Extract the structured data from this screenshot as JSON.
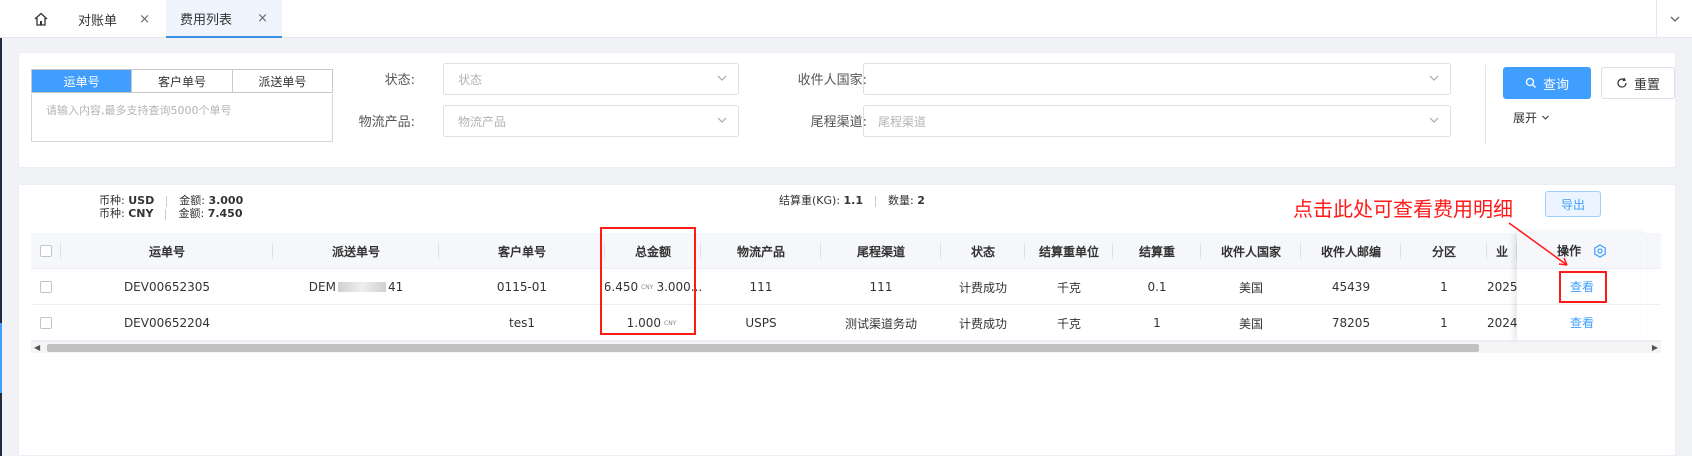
{
  "tabs": {
    "home_icon": "home-icon",
    "items": [
      {
        "label": "对账单",
        "close": "×"
      },
      {
        "label": "费用列表",
        "close": "×"
      }
    ]
  },
  "filter": {
    "seg_tabs": [
      "运单号",
      "客户单号",
      "派送单号"
    ],
    "textarea_placeholder": "请输入内容,最多支持查询5000个单号",
    "status_label": "状态:",
    "status_placeholder": "状态",
    "country_label": "收件人国家:",
    "country_value": "",
    "product_label": "物流产品:",
    "product_placeholder": "物流产品",
    "lastmile_label": "尾程渠道:",
    "lastmile_placeholder": "尾程渠道",
    "query_label": "查询",
    "reset_label": "重置",
    "expand_label": "展开"
  },
  "summary": {
    "currency_label": "币种:",
    "amount_label": "金额:",
    "rows": [
      {
        "currency": "USD",
        "amount": "3.000"
      },
      {
        "currency": "CNY",
        "amount": "7.450"
      }
    ],
    "weight_label": "结算重(KG):",
    "weight": "1.1",
    "count_label": "数量:",
    "count": "2",
    "export_label": "导出"
  },
  "annotation": "点击此处可查看费用明细",
  "table": {
    "columns": [
      "运单号",
      "派送单号",
      "客户单号",
      "总金额",
      "物流产品",
      "尾程渠道",
      "状态",
      "结算重单位",
      "结算重",
      "收件人国家",
      "收件人邮编",
      "分区",
      "业"
    ],
    "action_header": "操作",
    "rows": [
      {
        "waybill": "DEV00652305",
        "delivery_prefix": "DEM",
        "delivery_suffix": "41",
        "customer": "0115-01",
        "amount_a": "6.450",
        "amount_unit": "CNY",
        "amount_b": "3.000...",
        "product": "111",
        "lastmile": "111",
        "status": "计费成功",
        "unit": "千克",
        "weight": "0.1",
        "country": "美国",
        "zip": "45439",
        "zone": "1",
        "date": "2025",
        "action": "查看"
      },
      {
        "waybill": "DEV00652204",
        "delivery_prefix": "",
        "delivery_suffix": "",
        "customer": "tes1",
        "amount_a": "1.000",
        "amount_unit": "CNY",
        "amount_b": "",
        "product": "USPS",
        "lastmile": "测试渠道务动",
        "status": "计费成功",
        "unit": "千克",
        "weight": "1",
        "country": "美国",
        "zip": "78205",
        "zone": "1",
        "date": "2024",
        "action": "查看"
      }
    ]
  },
  "colors": {
    "primary": "#409eff",
    "annotation": "#ff1a1a"
  }
}
